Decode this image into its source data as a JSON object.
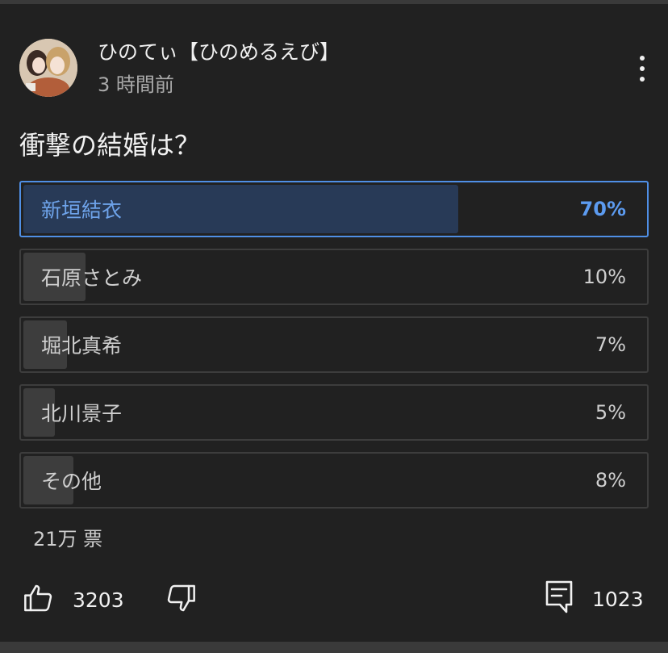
{
  "post": {
    "channel_name": "ひのてぃ【ひのめるえび】",
    "time_ago": "3 時間前",
    "question": "衝撃の結婚は？"
  },
  "poll": {
    "options": [
      {
        "label": "新垣結衣",
        "percent_text": "70%",
        "percent": 70,
        "selected": true
      },
      {
        "label": "石原さとみ",
        "percent_text": "10%",
        "percent": 10,
        "selected": false
      },
      {
        "label": "堀北真希",
        "percent_text": "7%",
        "percent": 7,
        "selected": false
      },
      {
        "label": "北川景子",
        "percent_text": "5%",
        "percent": 5,
        "selected": false
      },
      {
        "label": "その他",
        "percent_text": "8%",
        "percent": 8,
        "selected": false
      }
    ],
    "votes": "21万 票"
  },
  "actions": {
    "like_count": "3203",
    "comment_count": "1023",
    "icons": [
      "thumbs-up-icon",
      "thumbs-down-icon",
      "comment-icon",
      "more-vert-icon"
    ]
  },
  "colors": {
    "accent": "#5c9bf0",
    "selected_fill": "#283a57",
    "bar_fill": "#3d3d3d",
    "background": "#212121"
  }
}
